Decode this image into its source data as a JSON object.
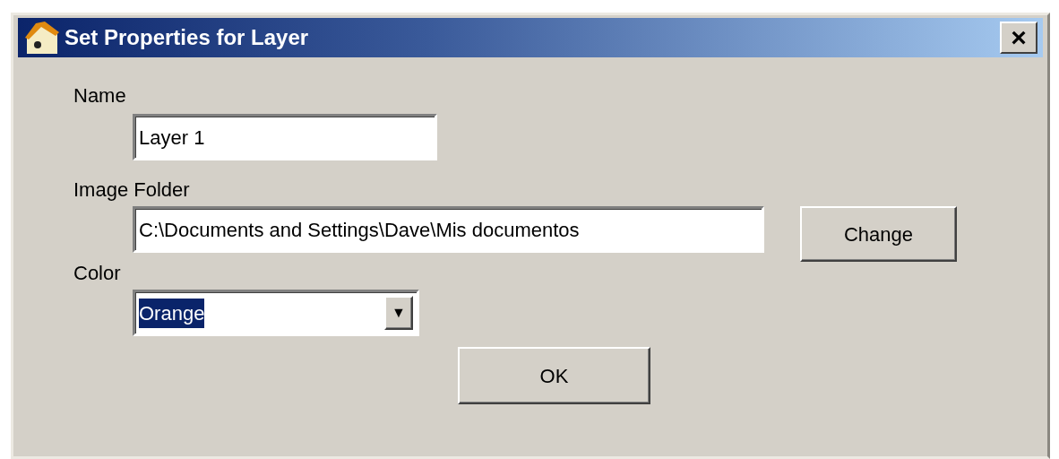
{
  "window": {
    "title": "Set Properties for Layer",
    "close": "×"
  },
  "name_field": {
    "label": "Name",
    "value": "Layer 1"
  },
  "image_folder": {
    "label": "Image Folder",
    "value": "C:\\Documents and Settings\\Dave\\Mis documentos",
    "button": "Change"
  },
  "color": {
    "label": "Color",
    "value": "Orange",
    "highlighted": true,
    "arrow": "▼"
  },
  "buttons": [
    "OK"
  ]
}
